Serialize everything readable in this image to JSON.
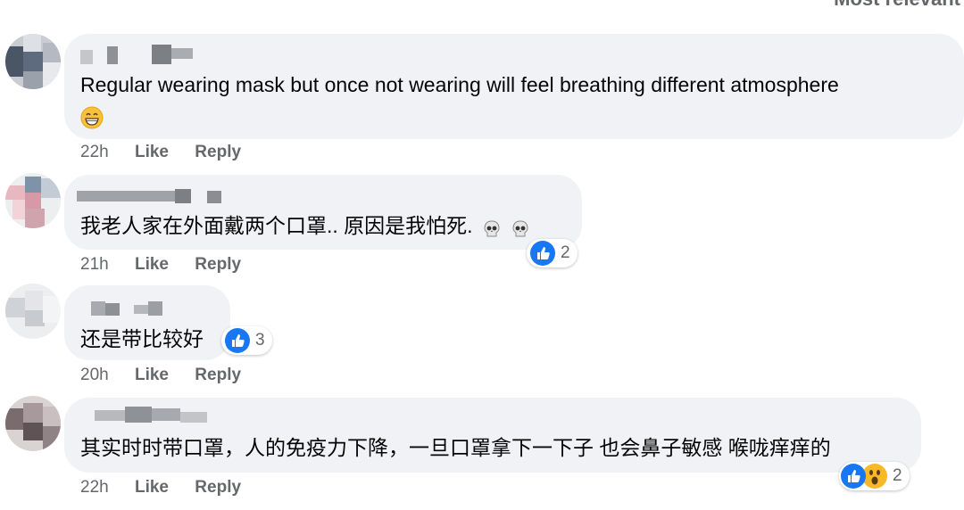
{
  "sort_label": "Most relevant",
  "comments": [
    {
      "text_line1": "Regular wearing mask but once not wearing will feel breathing different atmosphere",
      "emoji": "grinning-face-icon",
      "time": "22h",
      "like": "Like",
      "reply": "Reply",
      "reactions": []
    },
    {
      "text_line1": "我老人家在外面戴两个口罩.. 原因是我怕死.",
      "emoji": "skull-icon",
      "time": "21h",
      "like": "Like",
      "reply": "Reply",
      "reactions": [
        "like-icon"
      ],
      "reaction_count": "2"
    },
    {
      "text_line1": "还是带比较好",
      "time": "20h",
      "like": "Like",
      "reply": "Reply",
      "reactions": [
        "like-icon"
      ],
      "reaction_count": "3"
    },
    {
      "text_line1": "其实时时带口罩，人的免疫力下降，一旦口罩拿下一下子 也会鼻子敏感 喉咙痒痒的",
      "time": "22h",
      "like": "Like",
      "reply": "Reply",
      "reactions": [
        "like-icon",
        "wow-icon"
      ],
      "reaction_count": "2"
    }
  ],
  "colors": {
    "bubble": "#f0f2f5",
    "meta_text": "#65676b",
    "like_blue": "#1877f2",
    "wow_yellow": "#f7b928"
  }
}
